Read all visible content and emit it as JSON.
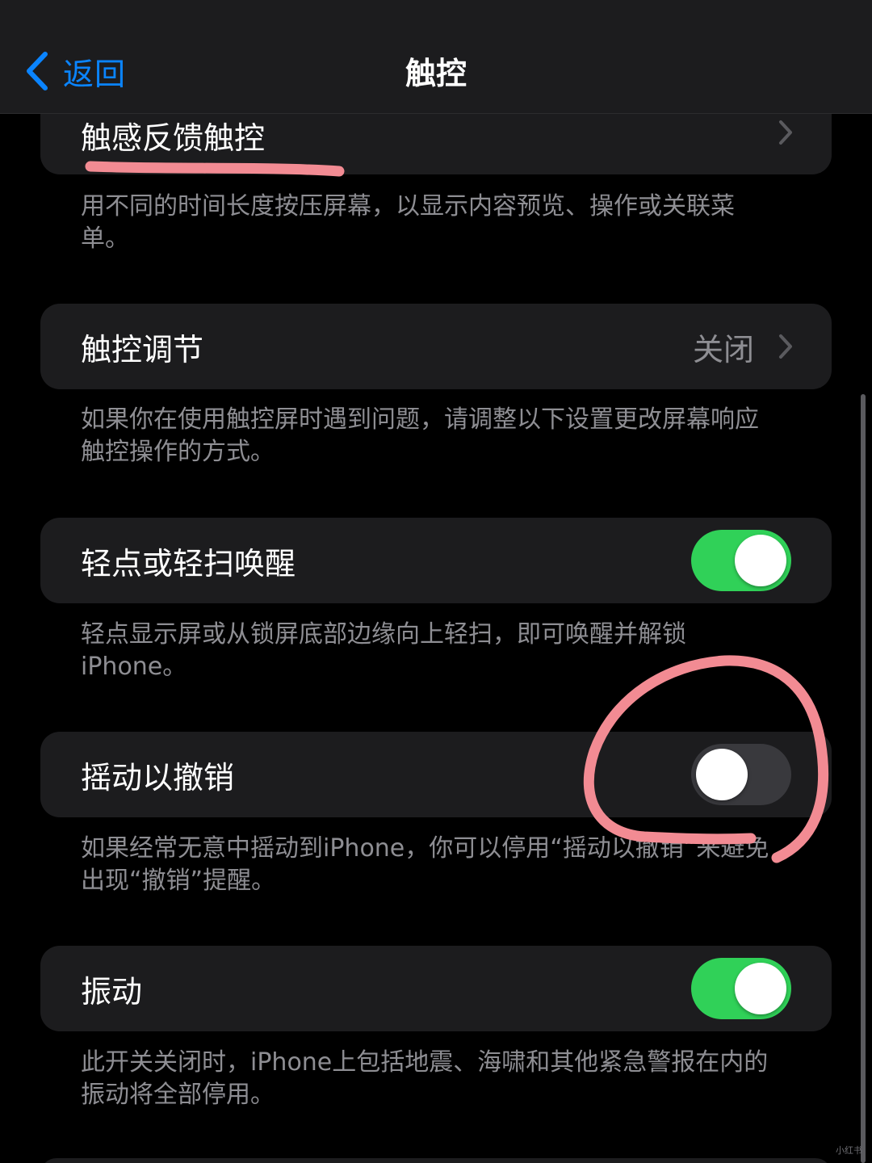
{
  "navbar": {
    "back_label": "返回",
    "title": "触控"
  },
  "sections": {
    "haptic": {
      "label": "触感反馈触控",
      "footer": "用不同的时间长度按压屏幕，以显示内容预览、操作或关联菜单。"
    },
    "touch_accommodations": {
      "label": "触控调节",
      "value": "关闭",
      "footer": "如果你在使用触控屏时遇到问题，请调整以下设置更改屏幕响应触控操作的方式。"
    },
    "tap_to_wake": {
      "label": "轻点或轻扫唤醒",
      "enabled": true,
      "footer": "轻点显示屏或从锁屏底部边缘向上轻扫，即可唤醒并解锁 iPhone。"
    },
    "shake_to_undo": {
      "label": "摇动以撤销",
      "enabled": false,
      "footer": "如果经常无意中摇动到iPhone，你可以停用“摇动以撤销”来避免出现“撤销”提醒。"
    },
    "vibration": {
      "label": "振动",
      "enabled": true,
      "footer": "此开关关闭时，iPhone上包括地震、海啸和其他紧急警报在内的振动将全部停用。"
    }
  },
  "colors": {
    "accent": "#0a84ff",
    "toggle_on": "#30d158",
    "toggle_off": "#39393d",
    "cell_background": "#1c1c1e",
    "secondary_text": "#8e8e93",
    "annotation": "#f28b93"
  },
  "icons": {
    "back": "chevron-left-icon",
    "disclosure": "chevron-right-icon"
  },
  "watermark": "小红书"
}
